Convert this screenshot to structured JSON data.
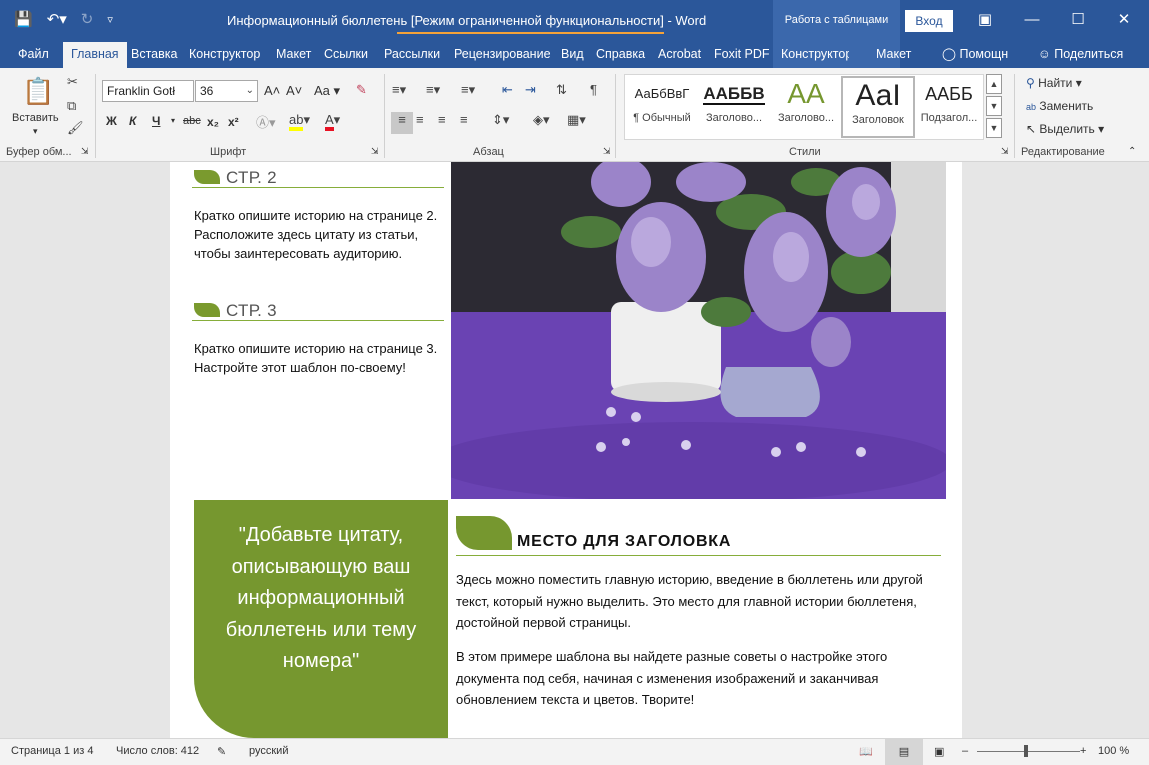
{
  "window": {
    "title": "Информационный бюллетень [Режим ограниченной функциональности]  -  Word",
    "context_tab": "Работа с таблицами",
    "login_label": "Вход"
  },
  "qat": {
    "save_icon": "save-icon",
    "undo_icon": "undo-icon",
    "redo_icon": "redo-icon",
    "customize_icon": "customize-icon"
  },
  "tabs": [
    "Файл",
    "Главная",
    "Вставка",
    "Конструктор",
    "Макет",
    "Ссылки",
    "Рассылки",
    "Рецензирование",
    "Вид",
    "Справка",
    "Acrobat",
    "Foxit PDF",
    "Конструктор",
    "Макет"
  ],
  "tabs_right": {
    "help": "Помощн",
    "share": "Поделиться"
  },
  "ribbon": {
    "clipboard": {
      "paste": "Вставить",
      "label": "Буфер обм..."
    },
    "font": {
      "font_name": "Franklin Gotł",
      "font_size": "36",
      "label": "Шрифт",
      "bold": "Ж",
      "italic": "К",
      "underline": "Ч",
      "strike": "abc",
      "subscript": "x₂",
      "superscript": "x²",
      "grow": "A˄",
      "shrink": "A˅",
      "case": "Aa",
      "color_letter": "A"
    },
    "paragraph": {
      "label": "Абзац"
    },
    "styles": {
      "label": "Стили",
      "items": [
        {
          "preview": "АаБбВвГ",
          "name": "¶ Обычный"
        },
        {
          "preview": "ААББВ",
          "name": "Заголово..."
        },
        {
          "preview": "АА",
          "name": "Заголово..."
        },
        {
          "preview": "АаI",
          "name": "Заголовок"
        },
        {
          "preview": "ААББ",
          "name": "Подзагол..."
        }
      ]
    },
    "editing": {
      "find": "Найти",
      "replace": "Заменить",
      "select": "Выделить",
      "label": "Редактирование"
    }
  },
  "document": {
    "sections": [
      {
        "heading": "СТР. 2",
        "text": "Кратко опишите историю на странице 2. Расположите здесь цитату из статьи, чтобы заинтересовать аудиторию."
      },
      {
        "heading": "СТР. 3",
        "text": "Кратко опишите историю на странице 3. Настройте этот шаблон по-своему!"
      }
    ],
    "quote": "\"Добавьте цитату, описывающую ваш информационный бюллетень или тему номера\"",
    "main_heading": "МЕСТО ДЛЯ ЗАГОЛОВКА",
    "main_p1": "Здесь можно поместить главную историю, введение в бюллетень или другой текст, который нужно выделить. Это место для главной истории бюллетеня, достойной первой страницы.",
    "main_p2": "В этом примере шаблона вы найдете разные советы о настройке этого документа под себя, начиная с изменения изображений и заканчивая обновлением текста и цветов. Творите!"
  },
  "status": {
    "page": "Страница 1 из 4",
    "words": "Число слов: 412",
    "language": "русский",
    "zoom": "100 %"
  },
  "colors": {
    "title_bar": "#2b579a",
    "accent_green": "#76972f",
    "photo_purple": "#6b44b5"
  }
}
